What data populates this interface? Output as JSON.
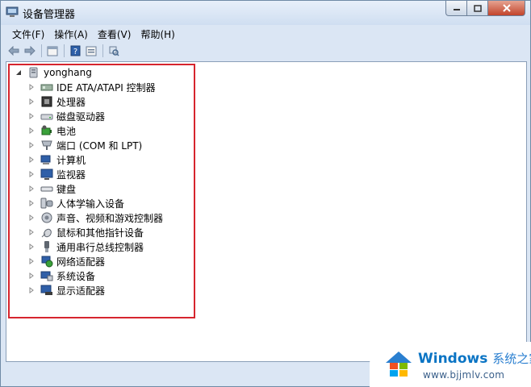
{
  "window": {
    "title": "设备管理器"
  },
  "menu": {
    "items": [
      "文件(F)",
      "操作(A)",
      "查看(V)",
      "帮助(H)"
    ]
  },
  "toolbar": {
    "icons": [
      "back-arrow-icon",
      "forward-arrow-icon",
      "properties-icon",
      "help-icon",
      "view-icon",
      "scan-hardware-icon"
    ]
  },
  "tree": {
    "root": "yonghang",
    "items": [
      {
        "label": "IDE ATA/ATAPI 控制器",
        "icon": "ide-controller-icon"
      },
      {
        "label": "处理器",
        "icon": "processor-icon"
      },
      {
        "label": "磁盘驱动器",
        "icon": "disk-drive-icon"
      },
      {
        "label": "电池",
        "icon": "battery-icon"
      },
      {
        "label": "端口 (COM 和 LPT)",
        "icon": "port-icon"
      },
      {
        "label": "计算机",
        "icon": "computer-icon"
      },
      {
        "label": "监视器",
        "icon": "monitor-icon"
      },
      {
        "label": "键盘",
        "icon": "keyboard-icon"
      },
      {
        "label": "人体学输入设备",
        "icon": "hid-icon"
      },
      {
        "label": "声音、视频和游戏控制器",
        "icon": "sound-icon"
      },
      {
        "label": "鼠标和其他指针设备",
        "icon": "mouse-icon"
      },
      {
        "label": "通用串行总线控制器",
        "icon": "usb-icon"
      },
      {
        "label": "网络适配器",
        "icon": "network-adapter-icon"
      },
      {
        "label": "系统设备",
        "icon": "system-device-icon"
      },
      {
        "label": "显示适配器",
        "icon": "display-adapter-icon"
      }
    ]
  },
  "watermark": {
    "brand": "Windows",
    "brand_cn": "系统之家",
    "url": "www.bjjmlv.com"
  },
  "colors": {
    "highlight": "#d6252e",
    "chrome": "#dbe6f4",
    "watermark_blue": "#0a74c4"
  }
}
